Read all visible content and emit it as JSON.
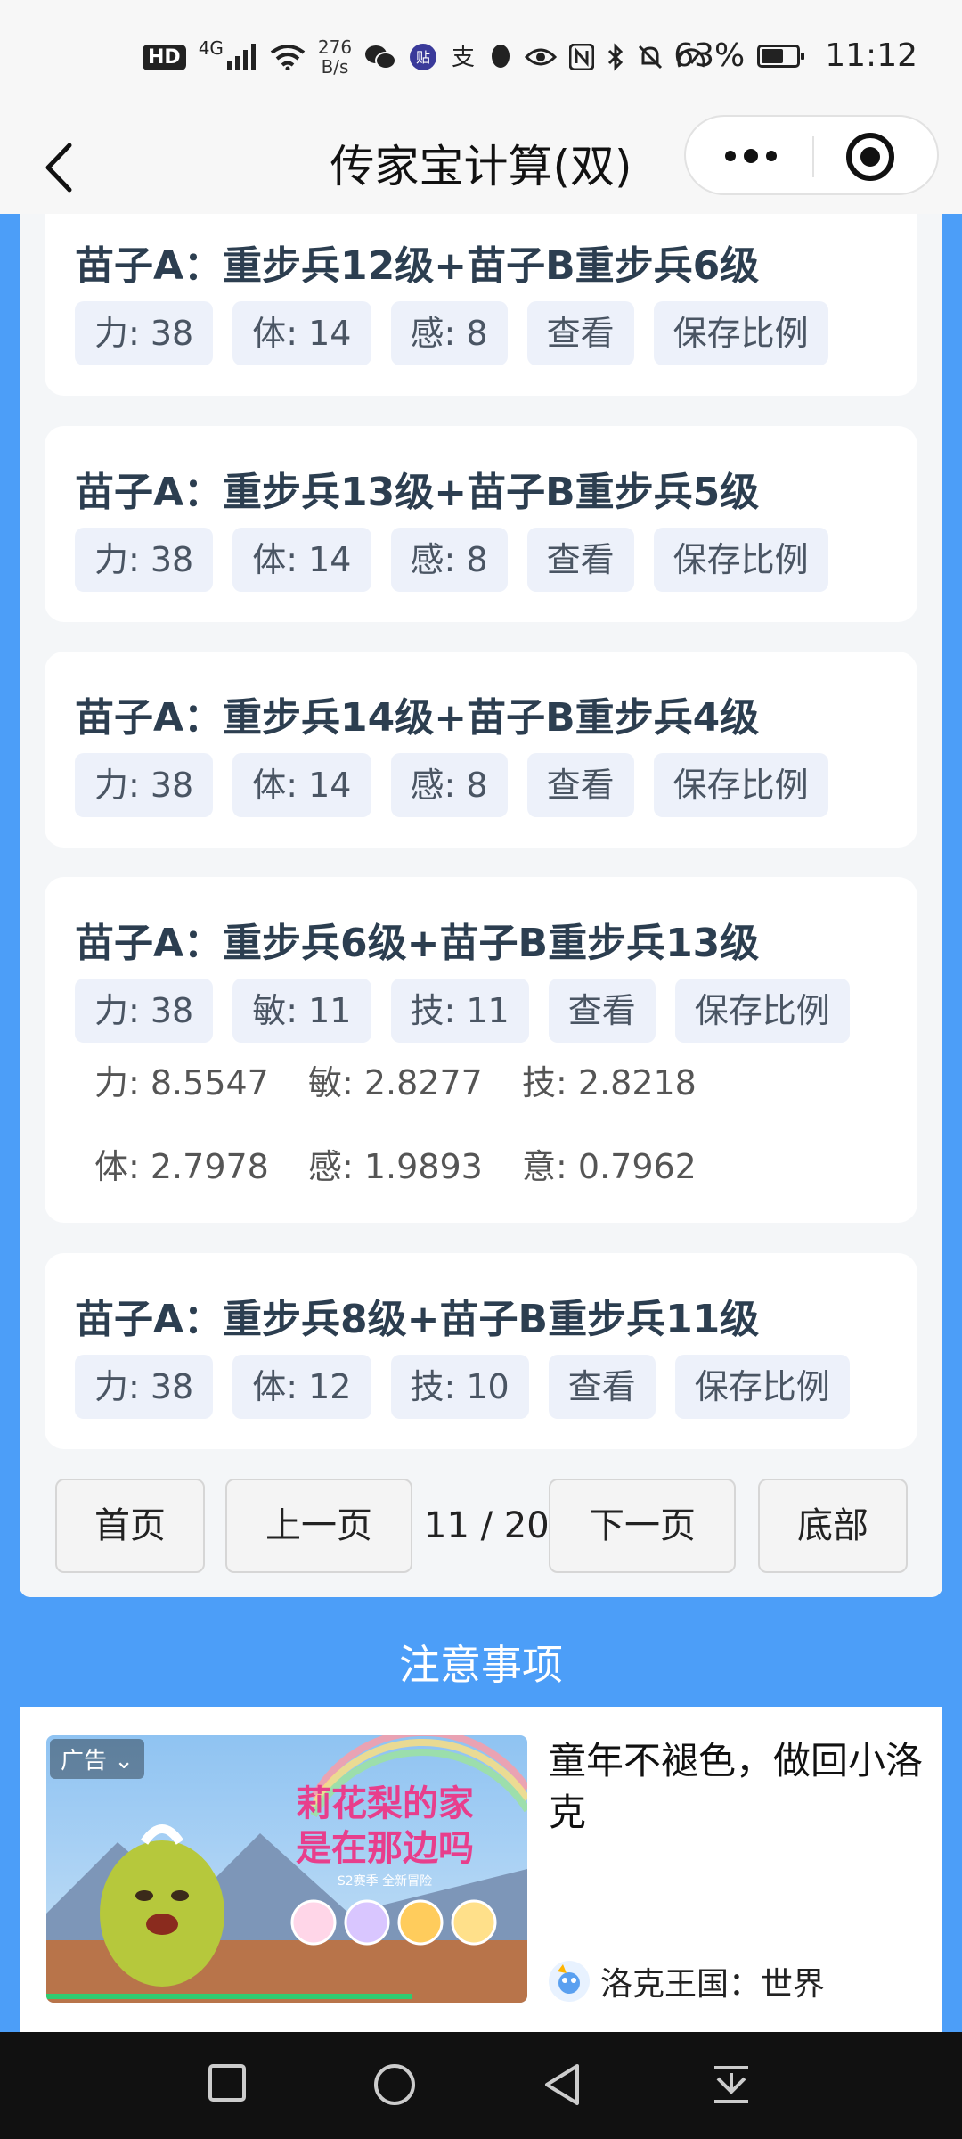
{
  "status_bar": {
    "hd": "HD",
    "network": "4G",
    "speed_value": "276",
    "speed_unit": "B/s",
    "battery": "63%",
    "battery_level": 0.63,
    "time": "11:12",
    "icons": [
      "signal-icon",
      "wifi-icon",
      "wechat-icon",
      "tieba-icon",
      "alipay-icon",
      "qq-icon",
      "eye-icon",
      "nfc-icon",
      "bluetooth-icon",
      "mute-icon",
      "speed-icon"
    ]
  },
  "nav": {
    "title": "传家宝计算(双)"
  },
  "cards": [
    {
      "title": "苗子A：重步兵12级+苗子B重步兵6级",
      "tags": [
        "力: 38",
        "体: 14",
        "感: 8"
      ],
      "view": "查看",
      "save": "保存比例"
    },
    {
      "title": "苗子A：重步兵13级+苗子B重步兵5级",
      "tags": [
        "力: 38",
        "体: 14",
        "感: 8"
      ],
      "view": "查看",
      "save": "保存比例"
    },
    {
      "title": "苗子A：重步兵14级+苗子B重步兵4级",
      "tags": [
        "力: 38",
        "体: 14",
        "感: 8"
      ],
      "view": "查看",
      "save": "保存比例"
    },
    {
      "title": "苗子A：重步兵6级+苗子B重步兵13级",
      "tags": [
        "力: 38",
        "敏: 11",
        "技: 11"
      ],
      "view": "查看",
      "save": "保存比例",
      "ratios": [
        [
          "力: 8.5547",
          "敏: 2.8277",
          "技: 2.8218"
        ],
        [
          "体: 2.7978",
          "感: 1.9893",
          "意: 0.7962"
        ]
      ]
    },
    {
      "title": "苗子A：重步兵8级+苗子B重步兵11级",
      "tags": [
        "力: 38",
        "体: 12",
        "技: 10"
      ],
      "view": "查看",
      "save": "保存比例"
    }
  ],
  "pager": {
    "first": "首页",
    "prev": "上一页",
    "info": "11 / 20",
    "next": "下一页",
    "last": "底部"
  },
  "notes_title": "注意事项",
  "ad": {
    "badge": "广告",
    "image_text_1": "莉花梨的家",
    "image_text_2": "是在那边吗",
    "image_text_3": "S2赛季 全新冒险",
    "headline": "童年不褪色，做回小洛克",
    "brand": "洛克王国：世界"
  },
  "colors": {
    "accent_blue": "#4c9ef8",
    "title_text": "#2c3e50",
    "tag_bg": "#edf1fa"
  }
}
